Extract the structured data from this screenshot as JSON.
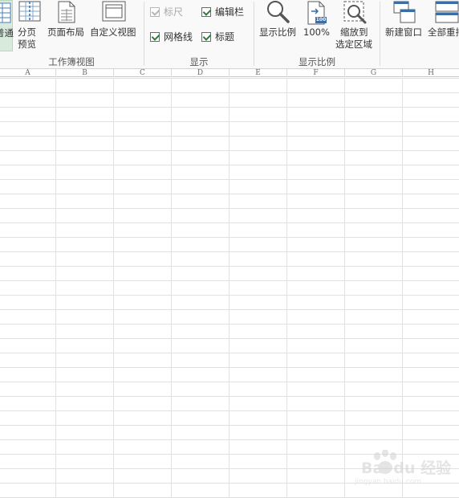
{
  "ribbon": {
    "normal_label": "普通",
    "page_break_label_1": "分页",
    "page_break_label_2": "预览",
    "page_layout_label": "页面布局",
    "custom_view_label": "自定义视图",
    "workbook_views_group": "工作簿视图",
    "ruler_label": "标尺",
    "formula_bar_label": "编辑栏",
    "gridlines_label": "网格线",
    "headings_label": "标题",
    "show_group": "显示",
    "zoom_label": "显示比例",
    "zoom100_label": "100%",
    "zoom100_badge": "100",
    "zoom_selection_label_1": "缩放到",
    "zoom_selection_label_2": "选定区域",
    "zoom_group": "显示比例",
    "new_window_label": "新建窗口",
    "arrange_all_label": "全部重排"
  },
  "checkboxes": {
    "ruler_checked": true,
    "ruler_disabled": true,
    "formula_bar_checked": true,
    "gridlines_checked": true,
    "headings_checked": true
  },
  "columns": [
    "A",
    "B",
    "C",
    "D",
    "E",
    "F",
    "G",
    "H"
  ],
  "watermark": {
    "text": "Bai du 经验",
    "sub": "jingyan.baidu.com"
  },
  "colors": {
    "accent_green": "#2f7a3f",
    "active_button_bg": "#d7eadb",
    "gridline": "#e1e1e1"
  }
}
